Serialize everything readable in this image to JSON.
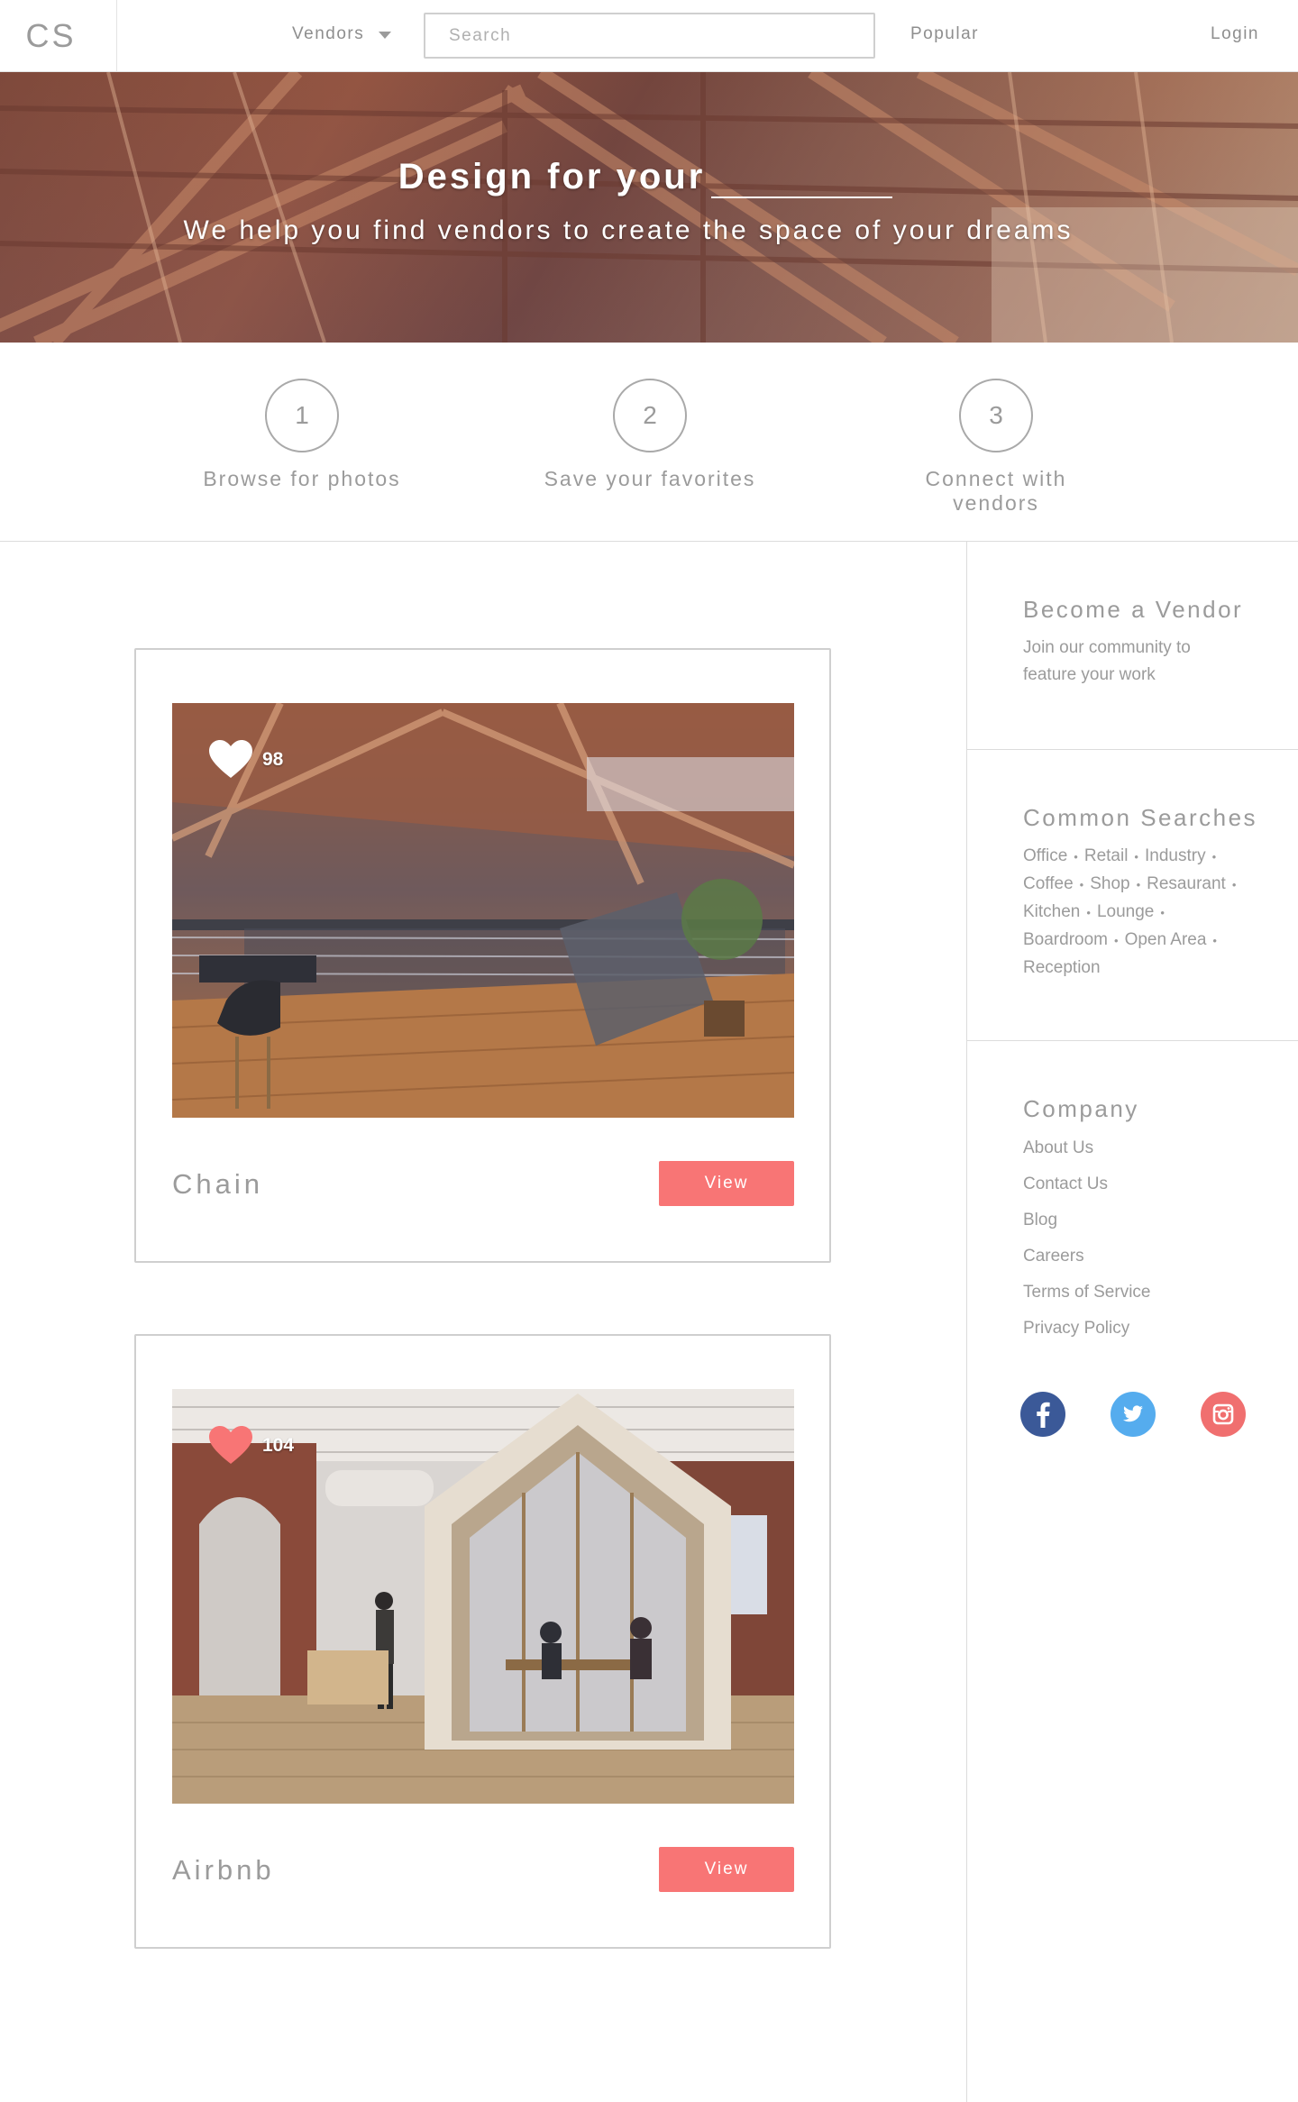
{
  "nav": {
    "logo": "CS",
    "vendors_label": "Vendors",
    "search_placeholder": "Search",
    "popular_label": "Popular",
    "login_label": "Login"
  },
  "hero": {
    "title": "Design for your",
    "subtitle": "We help you find vendors to create the space of your dreams"
  },
  "steps": [
    {
      "number": "1",
      "label": "Browse for photos"
    },
    {
      "number": "2",
      "label": "Save your favorites"
    },
    {
      "number": "3",
      "label": "Connect with vendors"
    }
  ],
  "sidebar": {
    "vendor": {
      "title": "Become a Vendor",
      "text_line1": "Join our community to",
      "text_line2": "feature your work"
    },
    "searches": {
      "title": "Common Searches",
      "tags": [
        "Office",
        "Retail",
        "Industry",
        "Coffee",
        "Shop",
        "Resaurant",
        "Kitchen",
        "Lounge",
        "Boardroom",
        "Open Area",
        "Reception"
      ]
    },
    "company": {
      "title": "Company",
      "links": [
        "About Us",
        "Contact Us",
        "Blog",
        "Careers",
        "Terms of Service",
        "Privacy Policy"
      ]
    },
    "social_icons": [
      "facebook-icon",
      "twitter-icon",
      "instagram-icon"
    ],
    "social_colors": {
      "facebook": "#3b5998",
      "twitter": "#55acee",
      "instagram": "#f06f6f"
    }
  },
  "cards": [
    {
      "name": "Chain",
      "likes": "98",
      "liked": false,
      "view_label": "View"
    },
    {
      "name": "Airbnb",
      "likes": "104",
      "liked": true,
      "view_label": "View"
    }
  ],
  "colors": {
    "accent": "#f87575",
    "liked_heart": "#f87575",
    "text": "#9b9b9b"
  }
}
